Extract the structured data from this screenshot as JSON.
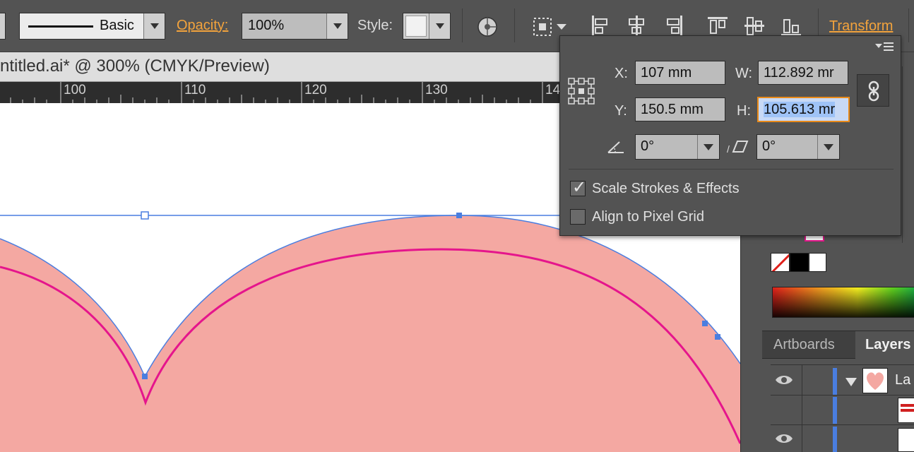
{
  "control_bar": {
    "stroke_style_label": "Basic",
    "opacity_label": "Opacity:",
    "opacity_value": "100%",
    "style_label": "Style:",
    "transform_label": "Transform"
  },
  "document": {
    "tab_title": "ntitled.ai* @ 300% (CMYK/Preview)",
    "ruler_labels": [
      "100",
      "110",
      "120",
      "130",
      "14"
    ]
  },
  "transform_panel": {
    "x_label": "X:",
    "x_value": "107 mm",
    "y_label": "Y:",
    "y_value": "150.5 mm",
    "w_label": "W:",
    "w_value": "112.892 mr",
    "h_label": "H:",
    "h_value": "105.613 mr",
    "rotate_value": "0°",
    "shear_value": "0°",
    "scale_strokes_label": "Scale Strokes & Effects",
    "scale_strokes_checked": true,
    "align_pixel_label": "Align to Pixel Grid",
    "align_pixel_checked": false
  },
  "panels": {
    "artboards_tab": "Artboards",
    "layers_tab": "Layers",
    "layer_name_partial": "La"
  },
  "colors": {
    "heart_fill": "#f4a8a2",
    "inner_stroke": "#e5158c",
    "selection": "#4a7ee0",
    "accent_orange": "#f3a33c"
  }
}
